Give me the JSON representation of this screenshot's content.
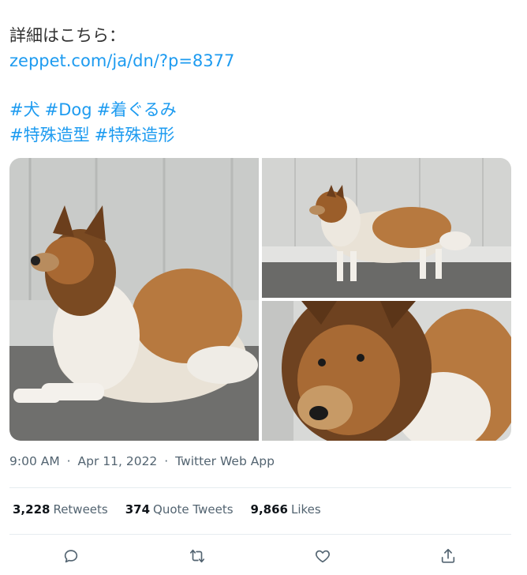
{
  "tweet": {
    "line1": "詳細はこちら：",
    "link": "zeppet.com/ja/dn/?p=8377",
    "hashtags_row1": [
      "#犬",
      "#Dog",
      "#着ぐるみ"
    ],
    "hashtags_row2": [
      "#特殊造型",
      "#特殊造形"
    ]
  },
  "meta": {
    "time": "9:00 AM",
    "date": "Apr 11, 2022",
    "app": "Twitter Web App",
    "separator": "·"
  },
  "stats": {
    "retweets_count": "3,228",
    "retweets_label": "Retweets",
    "quotes_count": "374",
    "quotes_label": "Quote Tweets",
    "likes_count": "9,866",
    "likes_label": "Likes"
  },
  "actions": [
    "reply-icon",
    "retweet-icon",
    "like-icon",
    "share-icon"
  ],
  "colors": {
    "link": "#1d9bf0",
    "secondary_text": "#536471",
    "divider": "#e6ecf0"
  }
}
